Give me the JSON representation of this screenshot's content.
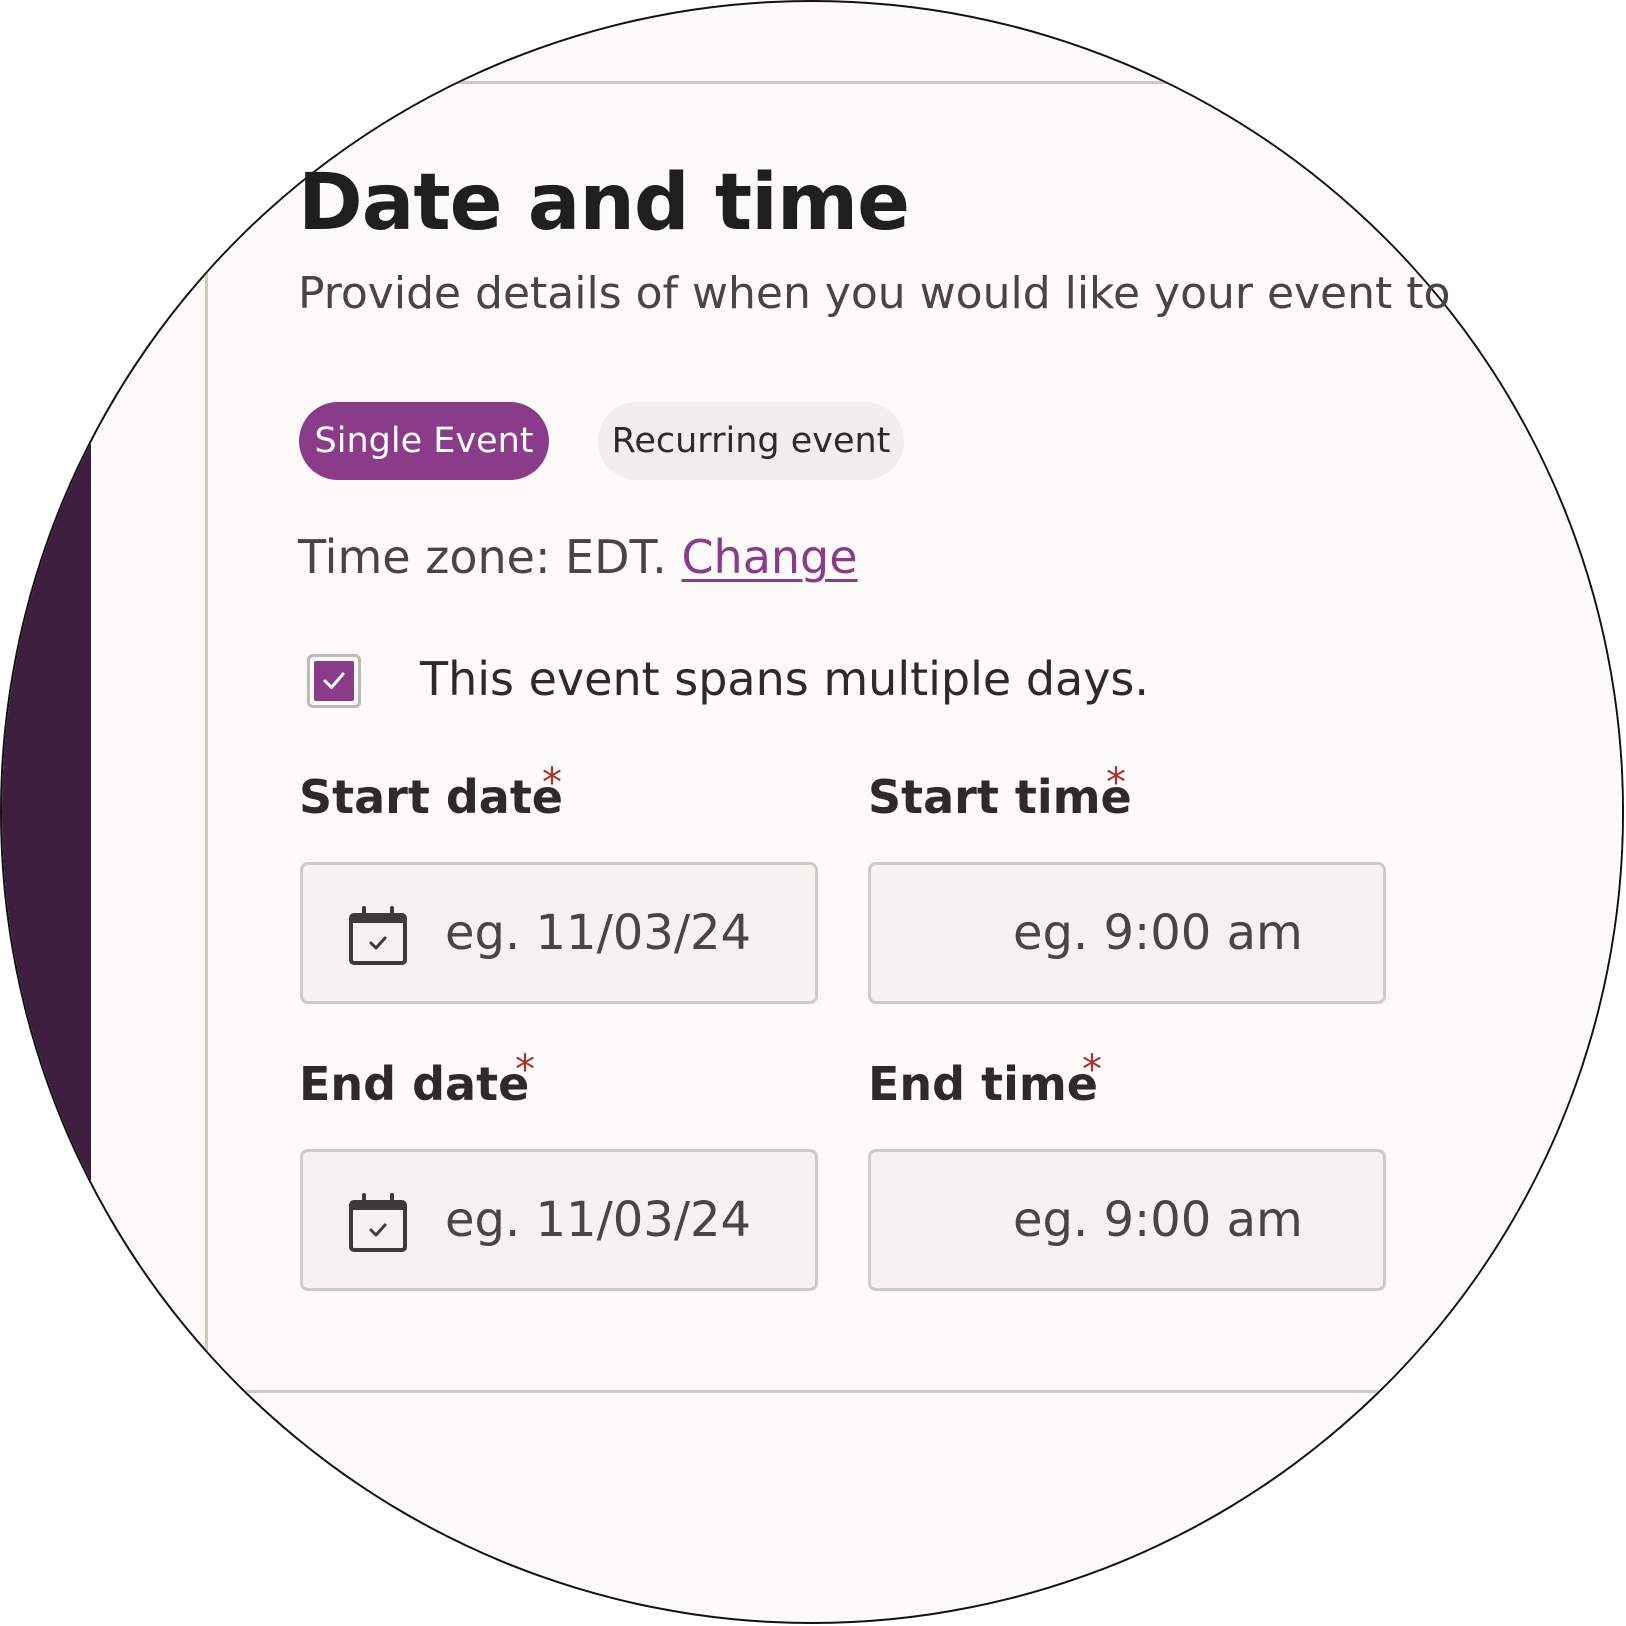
{
  "section": {
    "title": "Date and time",
    "subtitle": "Provide details of when you would like your event to"
  },
  "event_type_tabs": [
    {
      "label": "Single Event",
      "selected": true
    },
    {
      "label": "Recurring event",
      "selected": false
    }
  ],
  "timezone": {
    "prefix": "Time zone: EDT.",
    "change_link": "Change"
  },
  "multi_day": {
    "checked": true,
    "label": "This event spans multiple days."
  },
  "fields": {
    "start_date": {
      "label": "Start date",
      "required_mark": "*",
      "placeholder": "eg. 11/03/24"
    },
    "start_time": {
      "label": "Start time",
      "required_mark": "*",
      "placeholder": "eg. 9:00 am"
    },
    "end_date": {
      "label": "End date",
      "required_mark": "*",
      "placeholder": "eg. 11/03/24"
    },
    "end_time": {
      "label": "End time",
      "required_mark": "*",
      "placeholder": "eg. 9:00 am"
    }
  },
  "icons": {
    "date_field_icon": "calendar-check-icon",
    "checkbox_icon": "check-icon"
  },
  "colors": {
    "accent": "#8a3b8a",
    "sidebar": "#3f1f3f",
    "required": "#a8332e",
    "background": "#fcfbf9"
  }
}
